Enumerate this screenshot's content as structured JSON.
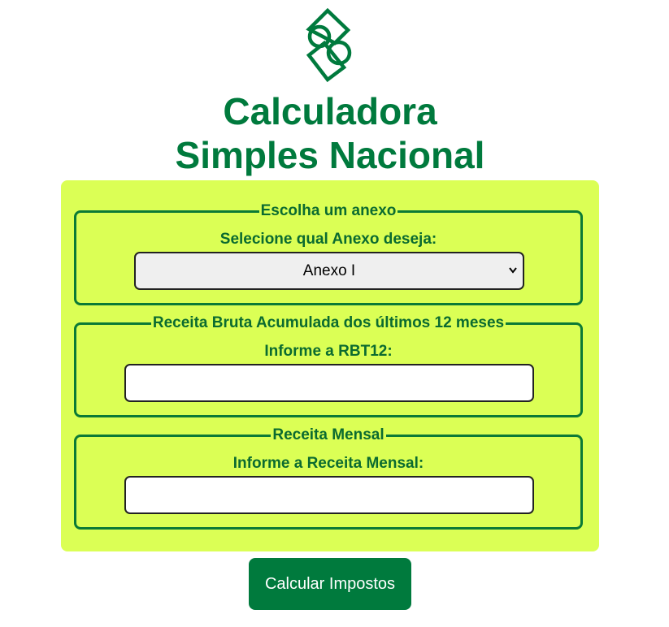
{
  "header": {
    "logo_icon": "simples-nacional-logo-icon",
    "title_line1": "Calculadora",
    "title_line2": "Simples Nacional"
  },
  "colors": {
    "brand_green": "#007a3d",
    "panel_background": "#dbff55",
    "group_border": "#0b7a36"
  },
  "form": {
    "annex_group": {
      "legend": "Escolha um anexo",
      "label": "Selecione qual Anexo deseja:",
      "selected": "Anexo I",
      "arrow_icon": "chevron-down-icon"
    },
    "rbt12_group": {
      "legend": "Receita Bruta Acumulada dos últimos 12 meses",
      "label": "Informe a RBT12:",
      "value": ""
    },
    "monthly_group": {
      "legend": "Receita Mensal",
      "label": "Informe a Receita Mensal:",
      "value": ""
    }
  },
  "actions": {
    "submit_label": "Calcular Impostos"
  }
}
